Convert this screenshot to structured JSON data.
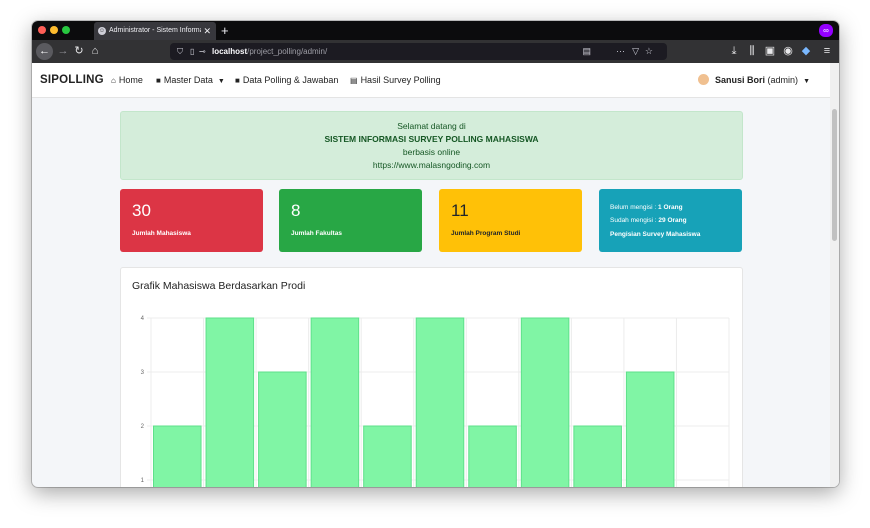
{
  "browser": {
    "tab_title": "Administrator - Sistem Informasi",
    "tab_close": "✕",
    "new_tab": "+",
    "url_host": "localhost",
    "url_path": "/project_polling/admin/"
  },
  "navbar": {
    "brand": "SIPOLLING",
    "home": "Home",
    "master_data": "Master Data",
    "data_polling": "Data Polling & Jawaban",
    "hasil_survey": "Hasil Survey Polling",
    "user_name": "Sanusi Bori",
    "user_role": "(admin)"
  },
  "welcome": {
    "line1": "Selamat datang di",
    "line2": "SISTEM INFORMASI SURVEY POLLING MAHASISWA",
    "line3": "berbasis online",
    "line4": "https://www.malasngoding.com"
  },
  "cards": [
    {
      "value": "30",
      "label": "Jumlah Mahasiswa",
      "color": "#dc3545"
    },
    {
      "value": "8",
      "label": "Jumlah Fakultas",
      "color": "#28a745"
    },
    {
      "value": "11",
      "label": "Jumlah Program Studi",
      "color": "#ffc107"
    }
  ],
  "survey_card": {
    "belum_label": "Belum mengisi : ",
    "belum_value": "1 Orang",
    "sudah_label": "Sudah mengisi : ",
    "sudah_value": "29 Orang",
    "label": "Pengisian Survey Mahasiswa",
    "color": "#17a2b8"
  },
  "chart_title": "Grafik Mahasiswa Berdasarkan Prodi",
  "chart_data": {
    "type": "bar",
    "categories": [
      "",
      "",
      "",
      "",
      "",
      "",
      "",
      "",
      "",
      "",
      ""
    ],
    "values": [
      2,
      4,
      3,
      4,
      2,
      4,
      2,
      4,
      2,
      3
    ],
    "yticks": [
      1,
      2,
      3,
      4
    ],
    "ylim": [
      0,
      4
    ],
    "grid": true,
    "bar_color": "#80f5a5"
  }
}
